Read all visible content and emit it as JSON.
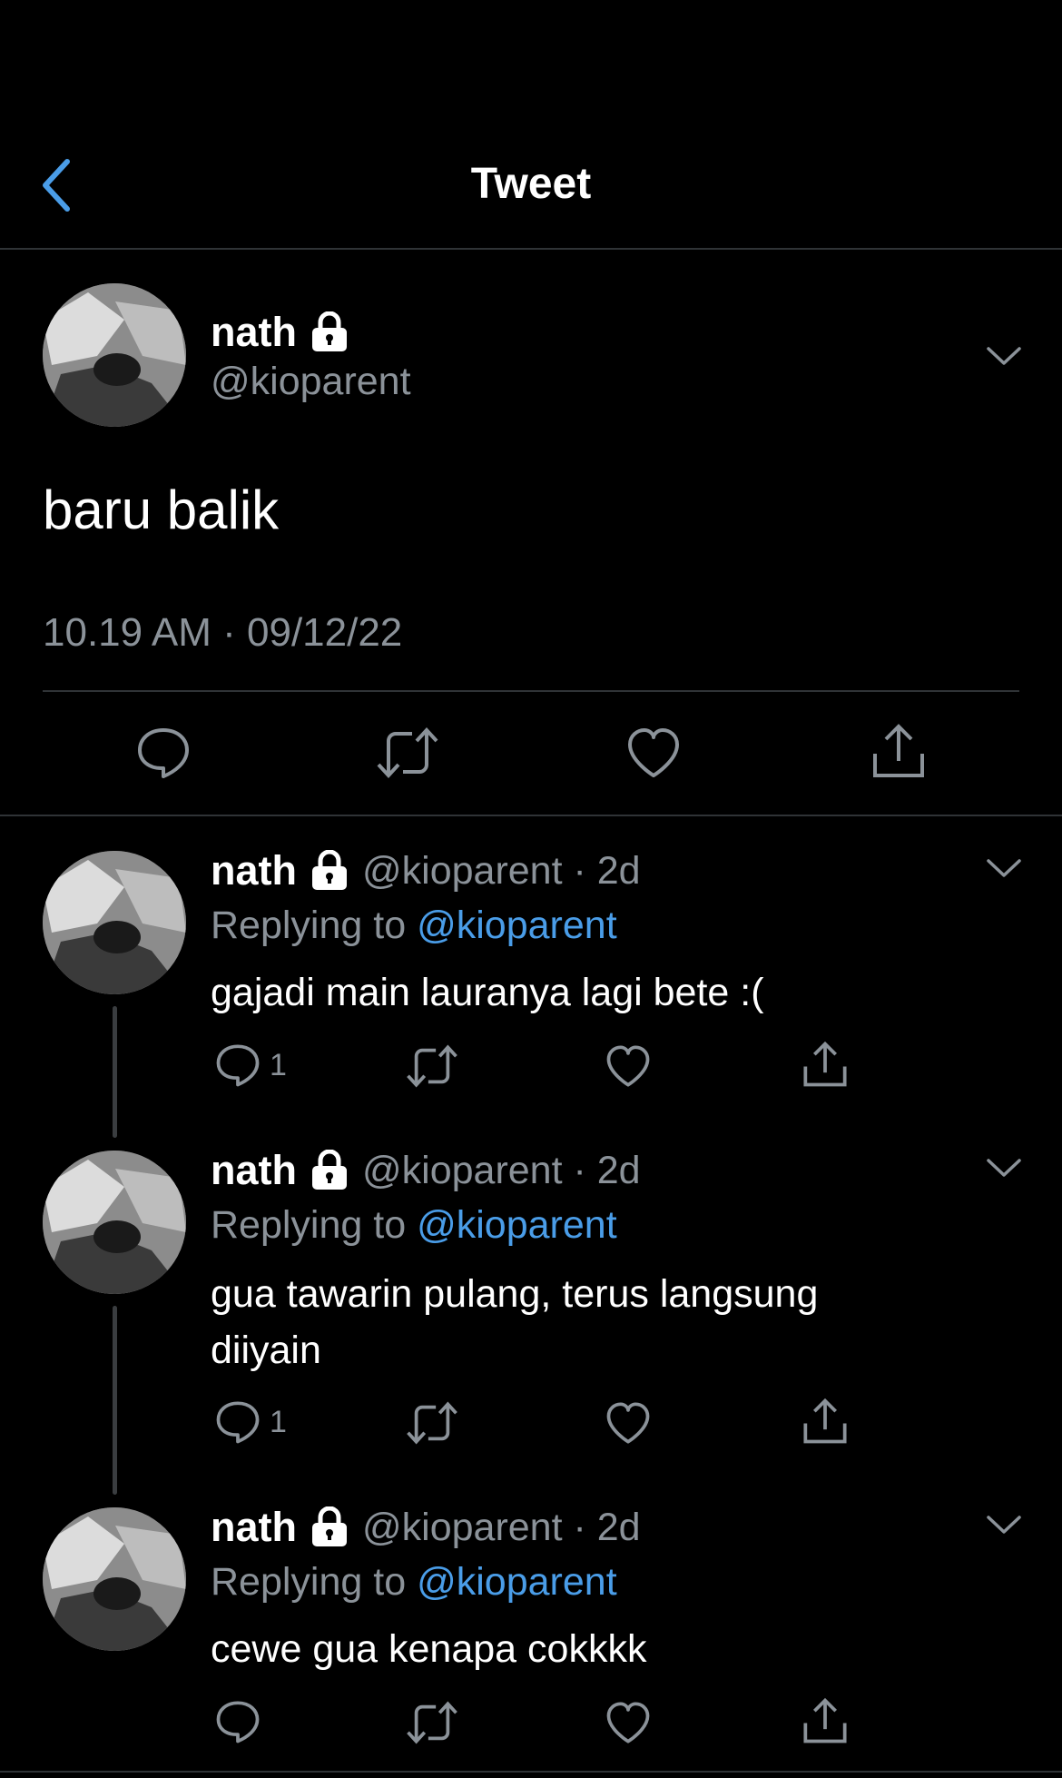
{
  "header": {
    "title": "Tweet",
    "back_icon": "chevron-left-icon"
  },
  "main_tweet": {
    "name": "nath",
    "handle": "@kioparent",
    "text": "baru balik",
    "timestamp": "10.19 AM · 09/12/22",
    "actions": [
      "reply-icon",
      "retweet-icon",
      "like-icon",
      "share-icon"
    ]
  },
  "replies": [
    {
      "name": "nath",
      "handle_time": "@kioparent · 2d",
      "replying_prefix": "Replying to",
      "replying_handle": "@kioparent",
      "text": "gajadi main lauranya lagi bete :(",
      "reply_count": "1"
    },
    {
      "name": "nath",
      "handle_time": "@kioparent · 2d",
      "replying_prefix": "Replying to",
      "replying_handle": "@kioparent",
      "text": "gua tawarin pulang, terus langsung diiyain",
      "reply_count": "1"
    },
    {
      "name": "nath",
      "handle_time": "@kioparent · 2d",
      "replying_prefix": "Replying to",
      "replying_handle": "@kioparent",
      "text": "cewe gua kenapa cokkkk",
      "reply_count": ""
    }
  ],
  "colors": {
    "accent": "#4a9de8",
    "secondary_text": "#8b9299",
    "background": "#000000"
  }
}
